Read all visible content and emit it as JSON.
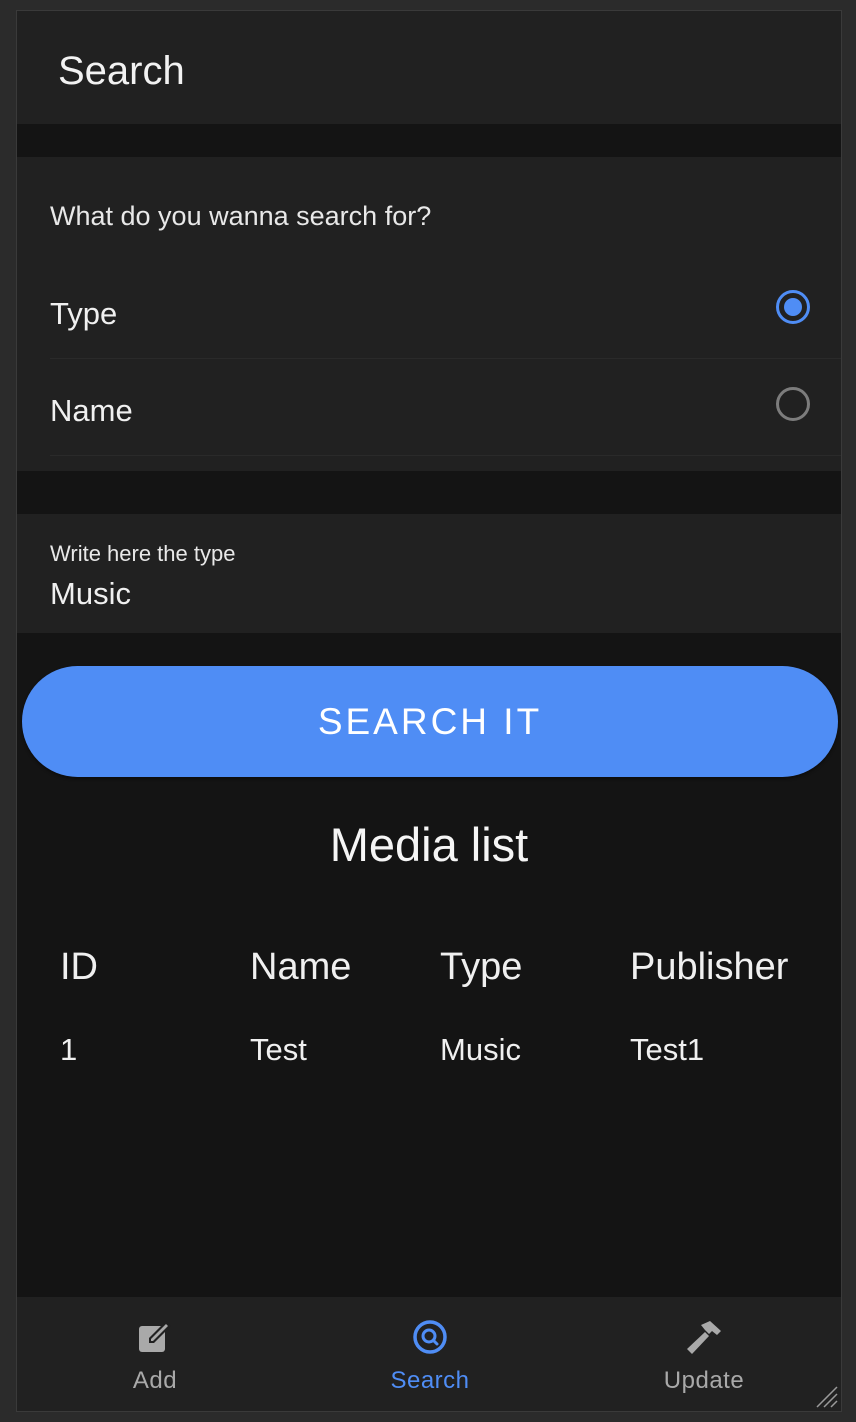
{
  "appbar": {
    "title": "Search"
  },
  "search_options": {
    "question": "What do you wanna search for?",
    "options": [
      {
        "label": "Type",
        "checked": true
      },
      {
        "label": "Name",
        "checked": false
      }
    ]
  },
  "type_input": {
    "label": "Write here the type",
    "value": "Music"
  },
  "search_button": {
    "label": "SEARCH IT"
  },
  "media_list": {
    "title": "Media list",
    "columns": [
      "ID",
      "Name",
      "Type",
      "Publisher"
    ],
    "rows": [
      [
        "1",
        "Test",
        "Music",
        "Test1"
      ]
    ]
  },
  "bottom_nav": {
    "items": [
      {
        "label": "Add",
        "icon": "edit-square-icon",
        "active": false
      },
      {
        "label": "Search",
        "icon": "search-circle-icon",
        "active": true
      },
      {
        "label": "Update",
        "icon": "hammer-icon",
        "active": false
      }
    ]
  },
  "colors": {
    "accent": "#4f8df5",
    "surface": "#212121",
    "background": "#141414"
  }
}
